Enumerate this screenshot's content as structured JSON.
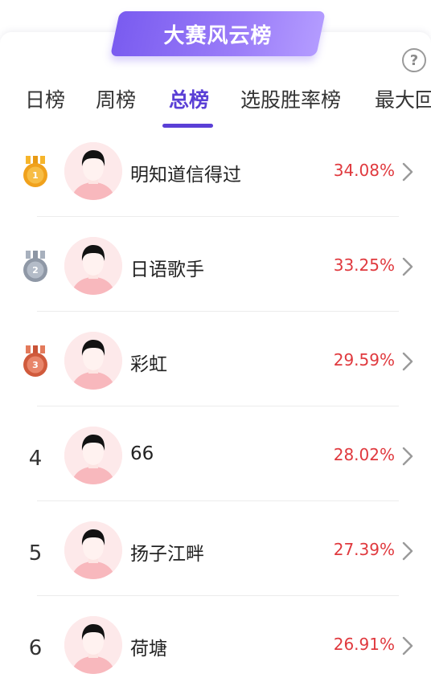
{
  "banner": {
    "title": "大赛风云榜"
  },
  "help": {
    "icon_text": "?"
  },
  "tabs": [
    {
      "label": "日榜"
    },
    {
      "label": "周榜"
    },
    {
      "label": "总榜"
    },
    {
      "label": "选股胜率榜"
    },
    {
      "label": "最大回"
    }
  ],
  "active_tab": "总榜",
  "colors": {
    "accent": "#5a3fd6",
    "rate": "#e0393e",
    "gold": "#f0a11c",
    "silver": "#8f98a6",
    "bronze": "#d05a3c",
    "avatar_bg": "#fde9ea"
  },
  "leaderboard": [
    {
      "rank": "1",
      "medal": "gold-medal-icon",
      "name": "明知道信得过",
      "rate": "34.08%"
    },
    {
      "rank": "2",
      "medal": "silver-medal-icon",
      "name": "日语歌手",
      "rate": "33.25%"
    },
    {
      "rank": "3",
      "medal": "bronze-medal-icon",
      "name": "彩虹",
      "rate": "29.59%"
    },
    {
      "rank": "4",
      "name": "66",
      "rate": "28.02%"
    },
    {
      "rank": "5",
      "name": "扬子江畔",
      "rate": "27.39%"
    },
    {
      "rank": "6",
      "name": "荷塘",
      "rate": "26.91%"
    }
  ]
}
